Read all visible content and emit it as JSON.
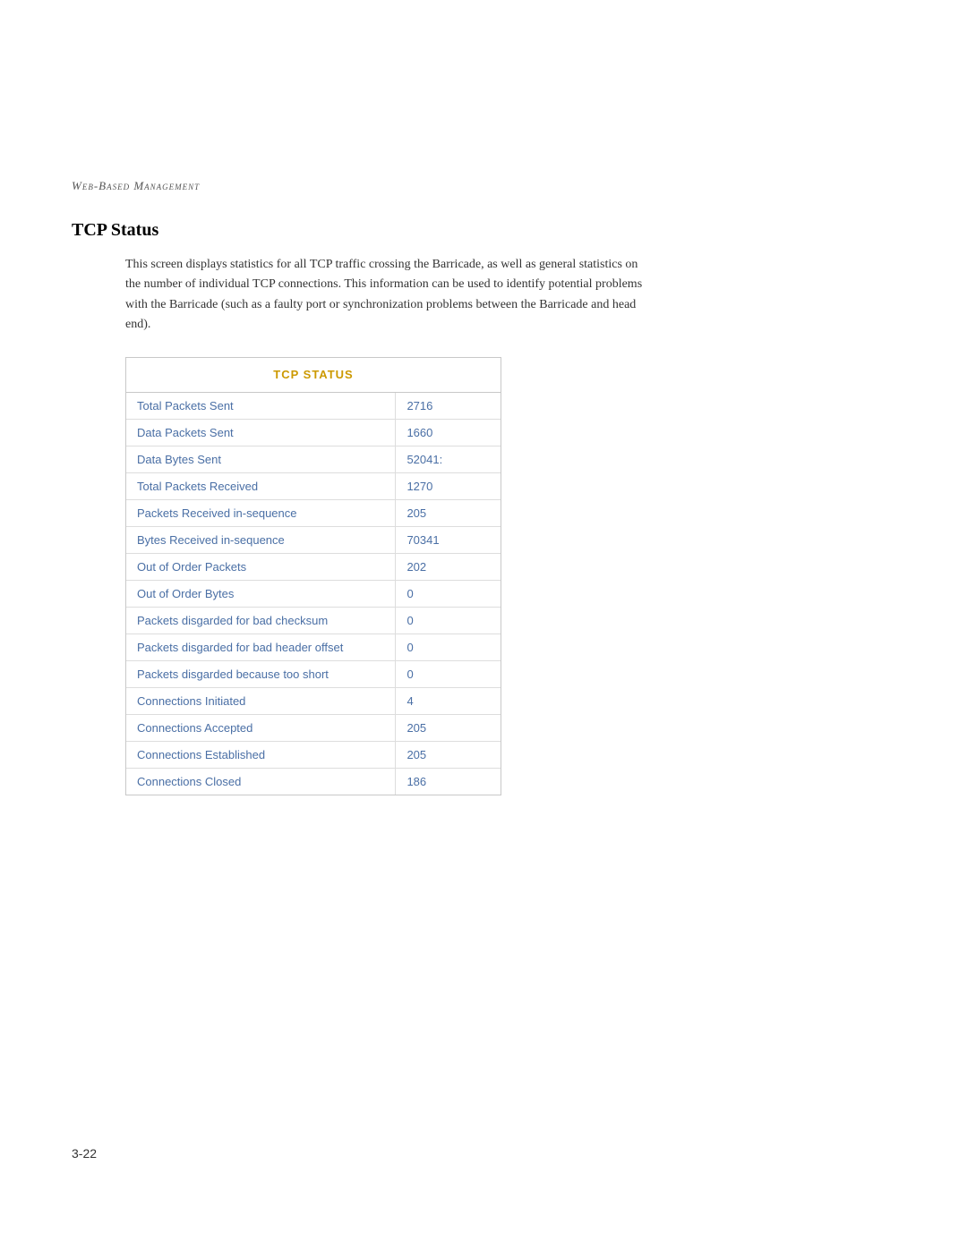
{
  "header": {
    "label": "Web-Based Management"
  },
  "section": {
    "title": "TCP Status",
    "description": "This screen displays statistics for all TCP traffic crossing the Barricade, as well as general statistics on the number of individual TCP connections. This information can be used to identify potential problems with the Barricade (such as a faulty port or synchronization problems between the Barricade and head end)."
  },
  "table": {
    "header": "TCP STATUS",
    "rows": [
      {
        "label": "Total Packets Sent",
        "value": "2716"
      },
      {
        "label": "Data Packets Sent",
        "value": "1660"
      },
      {
        "label": "Data Bytes Sent",
        "value": "52041:"
      },
      {
        "label": "Total Packets Received",
        "value": "1270"
      },
      {
        "label": "Packets Received in-sequence",
        "value": "205"
      },
      {
        "label": "Bytes Received in-sequence",
        "value": "70341"
      },
      {
        "label": "Out of Order Packets",
        "value": "202"
      },
      {
        "label": "Out of Order Bytes",
        "value": "0"
      },
      {
        "label": "Packets disgarded for bad checksum",
        "value": "0"
      },
      {
        "label": "Packets disgarded for bad header offset",
        "value": "0"
      },
      {
        "label": "Packets disgarded because too short",
        "value": "0"
      },
      {
        "label": "Connections Initiated",
        "value": "4"
      },
      {
        "label": "Connections Accepted",
        "value": "205"
      },
      {
        "label": "Connections Established",
        "value": "205"
      },
      {
        "label": "Connections Closed",
        "value": "186"
      }
    ]
  },
  "page_number": "3-22"
}
